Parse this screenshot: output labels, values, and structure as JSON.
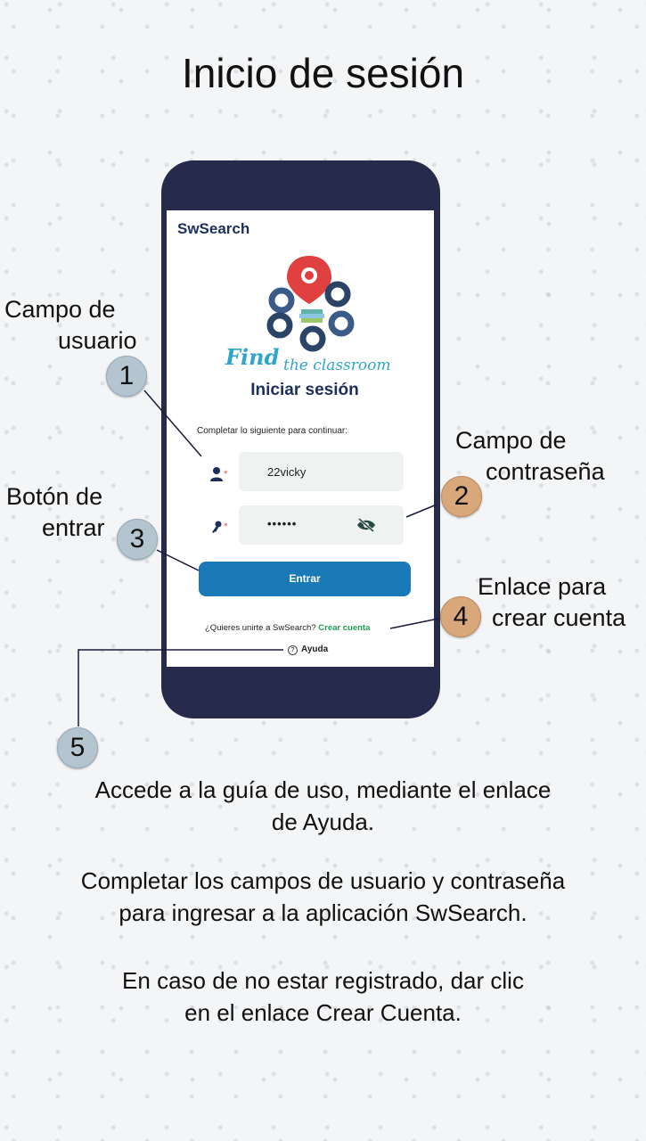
{
  "title": "Inicio de sesión",
  "app": {
    "name": "SwSearch",
    "logo_text_1": "Find",
    "logo_text_2": "the classroom",
    "login_title": "Iniciar sesión",
    "instructions": "Completar lo siguiente para continuar:",
    "username_value": "22vicky",
    "password_value": "••••••",
    "login_button": "Entrar",
    "join_text": "¿Quieres unirte a SwSearch?",
    "create_account_link": "Crear cuenta",
    "help_link": "Ayuda"
  },
  "annotations": [
    {
      "number": "1",
      "label_1": "Campo de",
      "label_2": "usuario"
    },
    {
      "number": "2",
      "label_1": "Campo de",
      "label_2": "contraseña"
    },
    {
      "number": "3",
      "label_1": "Botón de",
      "label_2": "entrar"
    },
    {
      "number": "4",
      "label_1": "Enlace para",
      "label_2": "crear cuenta"
    },
    {
      "number": "5"
    }
  ],
  "descriptions": [
    {
      "line_1": "Accede a la guía de uso, mediante el enlace",
      "line_2": "de Ayuda."
    },
    {
      "line_1": "Completar los campos de usuario y contraseña",
      "line_2": "para ingresar a la aplicación SwSearch."
    },
    {
      "line_1": "En caso de no estar registrado, dar clic",
      "line_2": "en el enlace Crear Cuenta."
    }
  ],
  "colors": {
    "phone_frame": "#262a4b",
    "button": "#1a7ab8",
    "link_green": "#1f9d55",
    "badge_blue": "#b5c5cf",
    "badge_orange": "#d8a87a"
  }
}
